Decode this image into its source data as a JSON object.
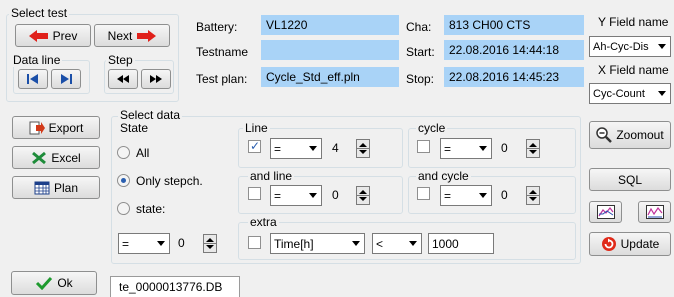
{
  "select_test": {
    "title": "Select test",
    "prev_label": "Prev",
    "next_label": "Next",
    "data_line_label": "Data line",
    "step_label": "Step"
  },
  "info": {
    "battery_label": "Battery:",
    "battery_value": "VL1220",
    "testname_label": "Testname",
    "testname_value": "",
    "testplan_label": "Test plan:",
    "testplan_value": "Cycle_Std_eff.pln",
    "cha_label": "Cha:",
    "cha_value": "813 CH00 CTS",
    "start_label": "Start:",
    "start_value": "22.08.2016 14:44:18",
    "stop_label": "Stop:",
    "stop_value": "22.08.2016 14:45:23"
  },
  "axes": {
    "y_label": "Y Field name",
    "y_value": "Ah-Cyc-Dis",
    "x_label": "X Field name",
    "x_value": "Cyc-Count"
  },
  "left_buttons": {
    "export": "Export",
    "excel": "Excel",
    "plan": "Plan"
  },
  "select_data": {
    "title": "Select data",
    "state_title": "State",
    "radio_all": "All",
    "radio_only": "Only stepch.",
    "radio_state": "state:",
    "state_op": "=",
    "state_value": "0",
    "line_title": "Line",
    "line_op": "=",
    "line_value": "4",
    "and_line_title": "and line",
    "and_line_op": "=",
    "and_line_value": "0",
    "cycle_title": "cycle",
    "cycle_op": "=",
    "cycle_value": "0",
    "and_cycle_title": "and cycle",
    "and_cycle_op": "=",
    "and_cycle_value": "0",
    "extra_title": "extra",
    "extra_field": "Time[h]",
    "extra_op": "<",
    "extra_value": "1000"
  },
  "right_buttons": {
    "zoomout": "Zoomout",
    "sql": "SQL",
    "update": "Update"
  },
  "bottom": {
    "ok": "Ok",
    "file_tab": "te_0000013776.DB"
  }
}
